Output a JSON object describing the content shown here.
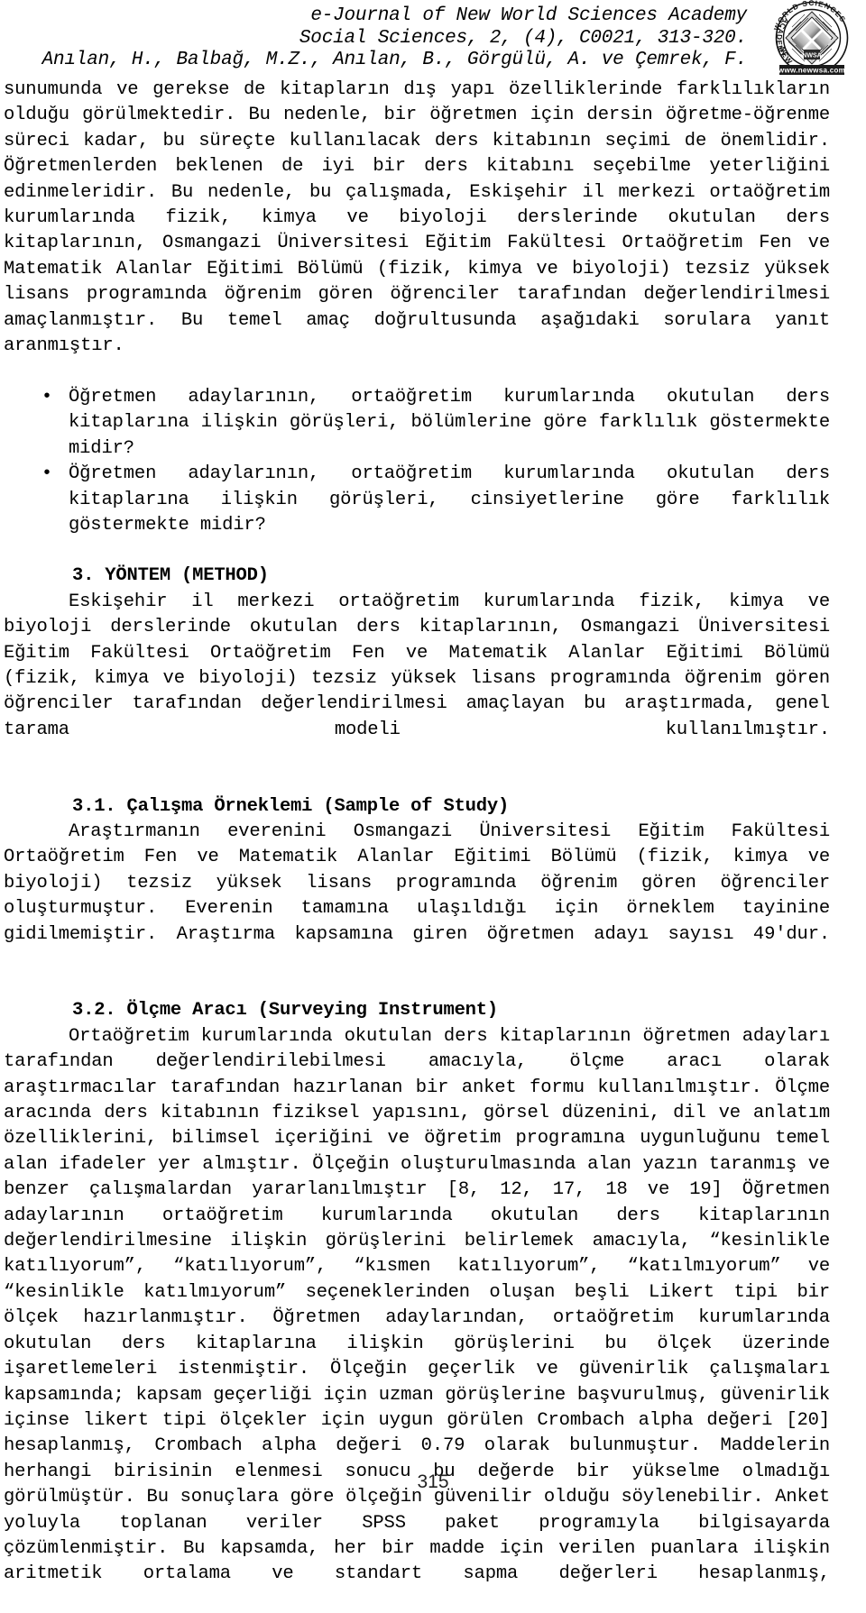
{
  "header": {
    "journal_line1": "e-Journal of New World Sciences Academy",
    "journal_line2": "Social Sciences, 2, (4), C0021, 313-320.",
    "authors": "Anılan, H., Balbağ, M.Z., Anılan, B., Görgülü, A. ve Çemrek, F.",
    "logo": {
      "outer_text_top": "SCIENCES",
      "outer_text_left": "WORLD",
      "outer_text_bottom_left": "NEW",
      "outer_text_right": "ACADEMY",
      "center_text": "NWSA",
      "url_text": "www.newwsa.com"
    }
  },
  "body": {
    "para_intro": "sunumunda ve gerekse de kitapların dış yapı özelliklerinde farklılıkların olduğu görülmektedir. Bu nedenle, bir öğretmen için dersin öğretme-öğrenme süreci kadar, bu süreçte kullanılacak ders kitabının seçimi de önemlidir. Öğretmenlerden beklenen de iyi bir ders kitabını seçebilme yeterliğini edinmeleridir. Bu nedenle, bu çalışmada, Eskişehir il merkezi ortaöğretim kurumlarında fizik, kimya ve biyoloji derslerinde okutulan ders kitaplarının, Osmangazi Üniversitesi Eğitim Fakültesi Ortaöğretim Fen ve Matematik Alanlar Eğitimi Bölümü (fizik, kimya ve biyoloji) tezsiz yüksek lisans programında öğrenim gören öğrenciler tarafından değerlendirilmesi amaçlanmıştır. Bu temel amaç doğrultusunda aşağıdaki sorulara yanıt aranmıştır.",
    "bullet_marker": "•",
    "questions": [
      "Öğretmen adaylarının, ortaöğretim kurumlarında okutulan ders kitaplarına ilişkin görüşleri, bölümlerine göre farklılık göstermekte midir?",
      "Öğretmen adaylarının, ortaöğretim kurumlarında okutulan ders kitaplarına ilişkin görüşleri, cinsiyetlerine göre farklılık göstermekte midir?"
    ],
    "section3_heading": "3. YÖNTEM (METHOD)",
    "section3_para": "Eskişehir il merkezi ortaöğretim kurumlarında fizik, kimya ve biyoloji derslerinde okutulan ders kitaplarının, Osmangazi Üniversitesi Eğitim Fakültesi Ortaöğretim Fen ve Matematik Alanlar Eğitimi Bölümü (fizik, kimya ve biyoloji) tezsiz yüksek lisans programında öğrenim gören öğrenciler tarafından değerlendirilmesi amaçlayan bu araştırmada, genel tarama modeli kullanılmıştır.",
    "section31_heading": "3.1. Çalışma Örneklemi (Sample of Study)",
    "section31_para": "Araştırmanın everenini Osmangazi Üniversitesi Eğitim Fakültesi Ortaöğretim Fen ve Matematik Alanlar Eğitimi Bölümü (fizik, kimya ve biyoloji) tezsiz yüksek lisans programında öğrenim gören öğrenciler oluşturmuştur. Everenin tamamına ulaşıldığı için örneklem tayinine gidilmemiştir. Araştırma kapsamına giren öğretmen adayı sayısı 49′dur.",
    "section32_heading": "3.2. Ölçme Aracı (Surveying Instrument)",
    "section32_para": "Ortaöğretim kurumlarında okutulan ders kitaplarının öğretmen adayları tarafından değerlendirilebilmesi amacıyla, ölçme aracı olarak araştırmacılar tarafından hazırlanan bir anket formu kullanılmıştır. Ölçme aracında ders kitabının fiziksel yapısını, görsel düzenini, dil ve anlatım özelliklerini, bilimsel içeriğini ve öğretim programına uygunluğunu temel alan ifadeler yer almıştır. Ölçeğin oluşturulmasında alan yazın taranmış ve benzer çalışmalardan yararlanılmıştır [8, 12, 17, 18 ve 19] Öğretmen adaylarının ortaöğretim kurumlarında okutulan ders kitaplarının değerlendirilmesine ilişkin görüşlerini belirlemek amacıyla, “kesinlikle katılıyorum”, “katılıyorum”, “kısmen katılıyorum”, “katılmıyorum” ve “kesinlikle katılmıyorum” seçeneklerinden oluşan beşli Likert tipi bir ölçek hazırlanmıştır. Öğretmen adaylarından, ortaöğretim kurumlarında okutulan ders kitaplarına ilişkin görüşlerini bu ölçek üzerinde işaretlemeleri istenmiştir. Ölçeğin geçerlik ve güvenirlik çalışmaları kapsamında; kapsam geçerliği için uzman görüşlerine başvurulmuş, güvenirlik içinse likert tipi ölçekler için uygun görülen Crombach alpha değeri [20] hesaplanmış, Crombach alpha değeri 0.79 olarak bulunmuştur. Maddelerin herhangi birisinin elenmesi sonucu bu değerde bir yükselme olmadığı görülmüştür. Bu sonuçlara göre ölçeğin güvenilir olduğu söylenebilir. Anket yoluyla toplanan veriler SPSS paket programıyla bilgisayarda çözümlenmiştir. Bu kapsamda, her bir madde için verilen puanlara ilişkin aritmetik ortalama ve standart sapma değerleri hesaplanmış,"
  },
  "footer": {
    "page_number": "315"
  }
}
